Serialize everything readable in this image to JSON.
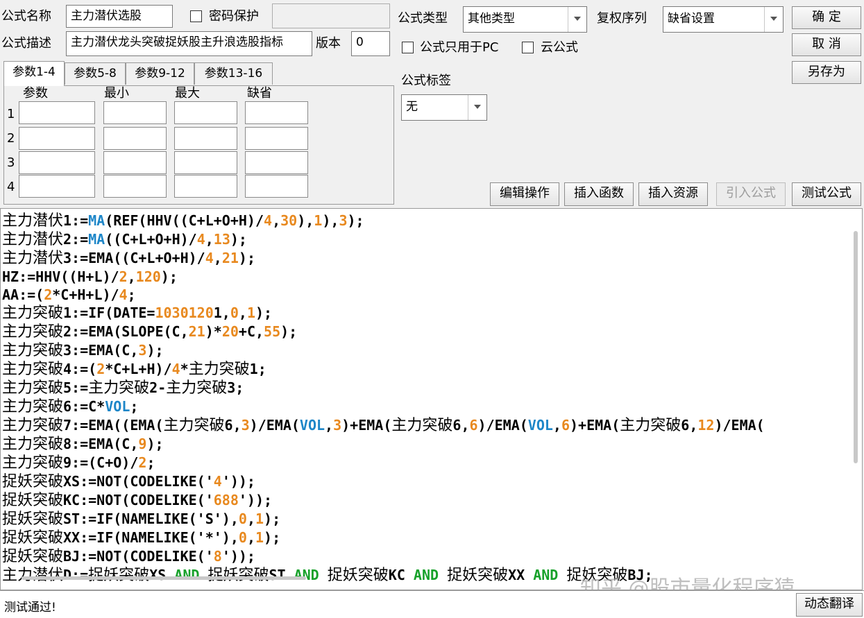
{
  "top": {
    "formula_name_label": "公式名称",
    "formula_name_value": "主力潜伏选股",
    "password_label": "密码保护",
    "formula_desc_label": "公式描述",
    "formula_desc_value": "主力潜伏龙头突破捉妖股主升浪选股指标",
    "version_label": "版本",
    "version_value": "0",
    "formula_type_label": "公式类型",
    "formula_type_value": "其他类型",
    "restore_seq_label": "复权序列",
    "restore_seq_value": "缺省设置",
    "pc_only_label": "公式只用于PC",
    "cloud_label": "云公式",
    "tag_label": "公式标签",
    "tag_value": "无"
  },
  "buttons": {
    "ok": "确 定",
    "cancel": "取 消",
    "save_as": "另存为",
    "edit_ops": "编辑操作",
    "insert_func": "插入函数",
    "insert_res": "插入资源",
    "import_formula": "引入公式",
    "test_formula": "测试公式",
    "dynamic_translate": "动态翻译"
  },
  "params": {
    "tabs": [
      "参数1-4",
      "参数5-8",
      "参数9-12",
      "参数13-16"
    ],
    "headers": [
      "参数",
      "最小",
      "最大",
      "缺省"
    ],
    "rows": [
      "1",
      "2",
      "3",
      "4"
    ]
  },
  "code_lines": [
    [
      [
        "主力潜伏",
        "cn"
      ],
      [
        "1:=",
        ""
      ],
      [
        "MA",
        "fb"
      ],
      [
        "(REF(HHV((C+L+O+H)/",
        ""
      ],
      [
        "4",
        "nm"
      ],
      [
        ",",
        ""
      ],
      [
        "30",
        "nm"
      ],
      [
        "),",
        ""
      ],
      [
        "1",
        "nm"
      ],
      [
        "),",
        ""
      ],
      [
        "3",
        "nm"
      ],
      [
        ");",
        ""
      ]
    ],
    [
      [
        "主力潜伏",
        "cn"
      ],
      [
        "2:=",
        ""
      ],
      [
        "MA",
        "fb"
      ],
      [
        "((C+L+O+H)/",
        ""
      ],
      [
        "4",
        "nm"
      ],
      [
        ",",
        ""
      ],
      [
        "13",
        "nm"
      ],
      [
        ");",
        ""
      ]
    ],
    [
      [
        "主力潜伏",
        "cn"
      ],
      [
        "3:=EMA((C+L+O+H)/",
        ""
      ],
      [
        "4",
        "nm"
      ],
      [
        ",",
        ""
      ],
      [
        "21",
        "nm"
      ],
      [
        ");",
        ""
      ]
    ],
    [
      [
        "HZ:=HHV((H+L)/",
        ""
      ],
      [
        "2",
        "nm"
      ],
      [
        ",",
        ""
      ],
      [
        "120",
        "nm"
      ],
      [
        ");",
        ""
      ]
    ],
    [
      [
        "AA:=(",
        ""
      ],
      [
        "2",
        "nm"
      ],
      [
        "*C+H+L)/",
        ""
      ],
      [
        "4",
        "nm"
      ],
      [
        ";",
        ""
      ]
    ],
    [
      [
        "主力突破",
        "cn"
      ],
      [
        "1:=IF(DATE=",
        ""
      ],
      [
        "1030120",
        "nm"
      ],
      [
        "1,",
        ""
      ],
      [
        "0",
        "nm"
      ],
      [
        ",",
        ""
      ],
      [
        "1",
        "nm"
      ],
      [
        ");",
        ""
      ]
    ],
    [
      [
        "主力突破",
        "cn"
      ],
      [
        "2:=EMA(SLOPE(C,",
        ""
      ],
      [
        "21",
        "nm"
      ],
      [
        ")*",
        ""
      ],
      [
        "20",
        "nm"
      ],
      [
        "+C,",
        ""
      ],
      [
        "55",
        "nm"
      ],
      [
        ");",
        ""
      ]
    ],
    [
      [
        "主力突破",
        "cn"
      ],
      [
        "3:=EMA(C,",
        ""
      ],
      [
        "3",
        "nm"
      ],
      [
        ");",
        ""
      ]
    ],
    [
      [
        "主力突破",
        "cn"
      ],
      [
        "4:=(",
        ""
      ],
      [
        "2",
        "nm"
      ],
      [
        "*C+L+H)/",
        ""
      ],
      [
        "4",
        "nm"
      ],
      [
        "*",
        ""
      ],
      [
        "主力突破",
        "cn"
      ],
      [
        "1;",
        ""
      ]
    ],
    [
      [
        "主力突破",
        "cn"
      ],
      [
        "5:=",
        ""
      ],
      [
        "主力突破",
        "cn"
      ],
      [
        "2-",
        ""
      ],
      [
        "主力突破",
        "cn"
      ],
      [
        "3;",
        ""
      ]
    ],
    [
      [
        "主力突破",
        "cn"
      ],
      [
        "6:=C*",
        ""
      ],
      [
        "VOL",
        "fb"
      ],
      [
        ";",
        ""
      ]
    ],
    [
      [
        "主力突破",
        "cn"
      ],
      [
        "7:=EMA((EMA(",
        ""
      ],
      [
        "主力突破",
        "cn"
      ],
      [
        "6,",
        ""
      ],
      [
        "3",
        "nm"
      ],
      [
        ")/EMA(",
        ""
      ],
      [
        "VOL",
        "fb"
      ],
      [
        ",",
        ""
      ],
      [
        "3",
        "nm"
      ],
      [
        ")+EMA(",
        ""
      ],
      [
        "主力突破",
        "cn"
      ],
      [
        "6,",
        ""
      ],
      [
        "6",
        "nm"
      ],
      [
        ")/EMA(",
        ""
      ],
      [
        "VOL",
        "fb"
      ],
      [
        ",",
        ""
      ],
      [
        "6",
        "nm"
      ],
      [
        ")+EMA(",
        ""
      ],
      [
        "主力突破",
        "cn"
      ],
      [
        "6,",
        ""
      ],
      [
        "12",
        "nm"
      ],
      [
        ")/EMA(",
        ""
      ]
    ],
    [
      [
        "主力突破",
        "cn"
      ],
      [
        "8:=EMA(C,",
        ""
      ],
      [
        "9",
        "nm"
      ],
      [
        ");",
        ""
      ]
    ],
    [
      [
        "主力突破",
        "cn"
      ],
      [
        "9:=(C+O)/",
        ""
      ],
      [
        "2",
        "nm"
      ],
      [
        ";",
        ""
      ]
    ],
    [
      [
        "捉妖突破",
        "cn"
      ],
      [
        "XS:=NOT(CODELIKE('",
        ""
      ],
      [
        "4",
        "nm"
      ],
      [
        "'));",
        ""
      ]
    ],
    [
      [
        "捉妖突破",
        "cn"
      ],
      [
        "KC:=NOT(CODELIKE('",
        ""
      ],
      [
        "688",
        "nm"
      ],
      [
        "'));",
        ""
      ]
    ],
    [
      [
        "捉妖突破",
        "cn"
      ],
      [
        "ST:=IF(NAMELIKE('S'),",
        ""
      ],
      [
        "0",
        "nm"
      ],
      [
        ",",
        ""
      ],
      [
        "1",
        "nm"
      ],
      [
        ");",
        ""
      ]
    ],
    [
      [
        "捉妖突破",
        "cn"
      ],
      [
        "XX:=IF(NAMELIKE('*'),",
        ""
      ],
      [
        "0",
        "nm"
      ],
      [
        ",",
        ""
      ],
      [
        "1",
        "nm"
      ],
      [
        ");",
        ""
      ]
    ],
    [
      [
        "捉妖突破",
        "cn"
      ],
      [
        "BJ:=NOT(CODELIKE('",
        ""
      ],
      [
        "8",
        "nm"
      ],
      [
        "'));",
        ""
      ]
    ],
    [
      [
        "主力潜伏",
        "cn"
      ],
      [
        "D:=",
        ""
      ],
      [
        "捉妖突破",
        "cn"
      ],
      [
        "XS ",
        ""
      ],
      [
        "AND",
        "fn"
      ],
      [
        " ",
        ""
      ],
      [
        "捉妖突破",
        "cn"
      ],
      [
        "ST ",
        ""
      ],
      [
        "AND",
        "fn"
      ],
      [
        " ",
        ""
      ],
      [
        "捉妖突破",
        "cn"
      ],
      [
        "KC ",
        ""
      ],
      [
        "AND",
        "fn"
      ],
      [
        " ",
        ""
      ],
      [
        "捉妖突破",
        "cn"
      ],
      [
        "XX ",
        ""
      ],
      [
        "AND",
        "fn"
      ],
      [
        " ",
        ""
      ],
      [
        "捉妖突破",
        "cn"
      ],
      [
        "BJ;",
        ""
      ]
    ]
  ],
  "status": {
    "message": "测试通过!",
    "watermark": "知乎 @股市量化程序猿"
  },
  "colors": {
    "function_green": "#17a12a",
    "builtin_blue": "#1d86c8",
    "number_orange": "#e8891f"
  }
}
